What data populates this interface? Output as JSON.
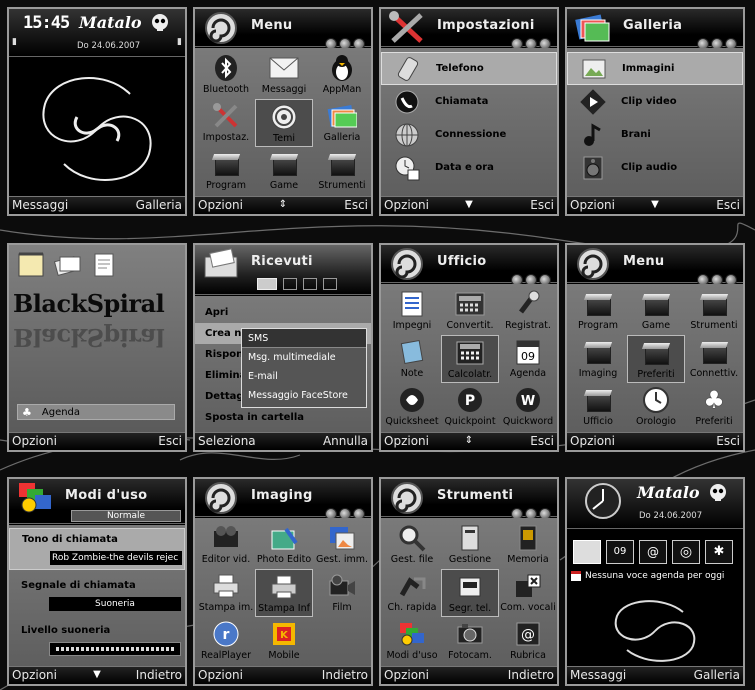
{
  "s1": {
    "clock": "15:45",
    "brand": "Matalo",
    "date": "Do 24.06.2007",
    "soft_left": "Messaggi",
    "soft_right": "Galleria"
  },
  "s2": {
    "title": "Menu",
    "items": [
      "Bluetooth",
      "Messaggi",
      "AppMan",
      "Impostaz.",
      "Temi",
      "Galleria",
      "Program",
      "Game",
      "Strumenti"
    ],
    "soft_left": "Opzioni",
    "soft_right": "Esci"
  },
  "s3": {
    "title": "Impostazioni",
    "items": [
      "Telefono",
      "Chiamata",
      "Connessione",
      "Data e ora"
    ],
    "soft_left": "Opzioni",
    "soft_right": "Esci"
  },
  "s4": {
    "title": "Galleria",
    "items": [
      "Immagini",
      "Clip video",
      "Brani",
      "Clip audio"
    ],
    "soft_left": "Opzioni",
    "soft_right": "Esci"
  },
  "s5": {
    "logo": "BlackSpiral",
    "agenda": "Agenda",
    "soft_left": "Opzioni",
    "soft_right": "Esci"
  },
  "s6": {
    "title": "Ricevuti",
    "items": [
      "Apri",
      "Crea n",
      "Rispon",
      "Elimina",
      "Dettag",
      "Sposta in cartella"
    ],
    "popup": [
      "SMS",
      "Msg. multimediale",
      "E-mail",
      "Messaggio FaceStore"
    ],
    "soft_left": "Seleziona",
    "soft_right": "Annulla"
  },
  "s7": {
    "title": "Ufficio",
    "items": [
      "Impegni",
      "Convertit.",
      "Registrat.",
      "Note",
      "Calcolatr.",
      "Agenda",
      "Quicksheet",
      "Quickpoint",
      "Quickword"
    ],
    "soft_left": "Opzioni",
    "soft_right": "Esci"
  },
  "s8": {
    "title": "Menu",
    "items": [
      "Program",
      "Game",
      "Strumenti",
      "Imaging",
      "Preferiti",
      "Connettiv.",
      "Ufficio",
      "Orologio",
      "Preferiti"
    ],
    "soft_left": "Opzioni",
    "soft_right": "Esci"
  },
  "s9": {
    "title": "Modi d'uso",
    "mode": "Normale",
    "label1": "Tono di chiamata",
    "value1": "Rob Zombie-the devils rejec",
    "label2": "Segnale di chiamata",
    "value2": "Suoneria",
    "label3": "Livello suoneria",
    "soft_left": "Opzioni",
    "soft_right": "Indietro"
  },
  "s10": {
    "title": "Imaging",
    "items": [
      "Editor vid.",
      "Photo Edito",
      "Gest. imm.",
      "Stampa im.",
      "Stampa Inf",
      "Film",
      "RealPlayer",
      "Mobile"
    ],
    "soft_left": "Opzioni",
    "soft_right": "Indietro"
  },
  "s11": {
    "title": "Strumenti",
    "items": [
      "Gest. file",
      "Gestione",
      "Memoria",
      "Ch. rapida",
      "Segr. tel.",
      "Com. vocali",
      "Modi d'uso",
      "Fotocam.",
      "Rubrica"
    ],
    "soft_left": "Opzioni",
    "soft_right": "Indietro"
  },
  "s12": {
    "brand": "Matalo",
    "date": "Do 24.06.2007",
    "agenda": "Nessuna voce agenda per oggi",
    "soft_left": "Messaggi",
    "soft_right": "Galleria"
  },
  "colors": {
    "frame": "#9a9a9a",
    "content": "#6a6a6a",
    "selected": "#4c4c4c"
  }
}
